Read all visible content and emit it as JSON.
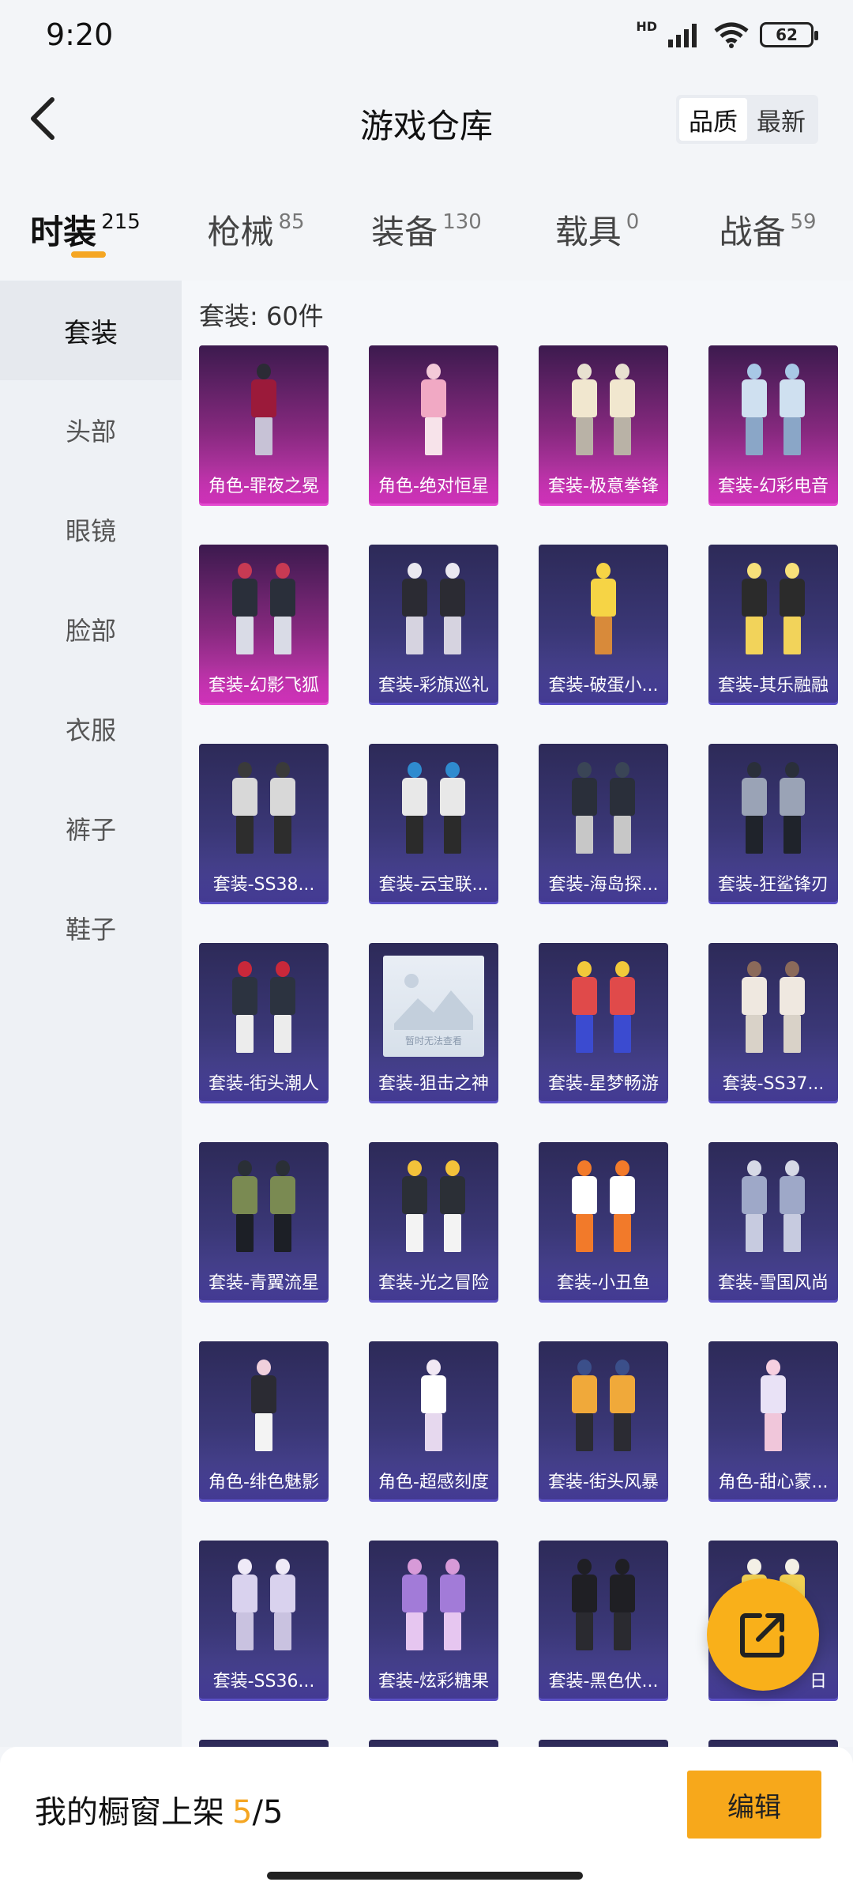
{
  "status": {
    "time": "9:20",
    "battery": "62",
    "network": "HD"
  },
  "header": {
    "title": "游戏仓库",
    "sort_options": [
      "品质",
      "最新"
    ],
    "sort_active": 0
  },
  "categories": [
    {
      "label": "时装",
      "count": "215"
    },
    {
      "label": "枪械",
      "count": "85"
    },
    {
      "label": "装备",
      "count": "130"
    },
    {
      "label": "载具",
      "count": "0"
    },
    {
      "label": "战备",
      "count": "59"
    }
  ],
  "sidebar": {
    "items": [
      "套装",
      "头部",
      "眼镜",
      "脸部",
      "衣服",
      "裤子",
      "鞋子"
    ]
  },
  "section": {
    "title": "套装: 60件"
  },
  "items": [
    {
      "label": "角色-罪夜之冕",
      "theme": "pink"
    },
    {
      "label": "角色-绝对恒星",
      "theme": "pink"
    },
    {
      "label": "套装-极意拳锋",
      "theme": "pink"
    },
    {
      "label": "套装-幻彩电音",
      "theme": "pink"
    },
    {
      "label": "套装-幻影飞狐",
      "theme": "pink"
    },
    {
      "label": "套装-彩旗巡礼",
      "theme": "blue"
    },
    {
      "label": "套装-破蛋小...",
      "theme": "blue"
    },
    {
      "label": "套装-其乐融融",
      "theme": "blue"
    },
    {
      "label": "套装-SS38...",
      "theme": "blue"
    },
    {
      "label": "套装-云宝联...",
      "theme": "blue"
    },
    {
      "label": "套装-海岛探...",
      "theme": "blue"
    },
    {
      "label": "套装-狂鲨锋刃",
      "theme": "blue"
    },
    {
      "label": "套装-街头潮人",
      "theme": "blue"
    },
    {
      "label": "套装-狙击之神",
      "theme": "blue",
      "placeholder": "暂时无法查看"
    },
    {
      "label": "套装-星梦畅游",
      "theme": "blue"
    },
    {
      "label": "套装-SS37...",
      "theme": "blue"
    },
    {
      "label": "套装-青翼流星",
      "theme": "blue"
    },
    {
      "label": "套装-光之冒险",
      "theme": "blue"
    },
    {
      "label": "套装-小丑鱼",
      "theme": "blue"
    },
    {
      "label": "套装-雪国风尚",
      "theme": "blue"
    },
    {
      "label": "角色-绯色魅影",
      "theme": "blue"
    },
    {
      "label": "角色-超感刻度",
      "theme": "blue"
    },
    {
      "label": "套装-街头风暴",
      "theme": "blue"
    },
    {
      "label": "角色-甜心蒙...",
      "theme": "blue"
    },
    {
      "label": "套装-SS36...",
      "theme": "blue"
    },
    {
      "label": "套装-炫彩糖果",
      "theme": "blue"
    },
    {
      "label": "套装-黑色伏...",
      "theme": "blue"
    },
    {
      "label": "日",
      "theme": "blue"
    },
    {
      "label": "",
      "theme": "blue"
    },
    {
      "label": "",
      "theme": "blue"
    },
    {
      "label": "",
      "theme": "blue"
    },
    {
      "label": "",
      "theme": "blue"
    }
  ],
  "shelf": {
    "label": "我的橱窗上架",
    "current": "5",
    "separator": "/",
    "total": "5"
  },
  "edit_button": "编辑",
  "fab": {
    "icon": "share-external-icon"
  },
  "colors": {
    "accent": "#f7a81b",
    "card_pink": "#d33bbb",
    "card_blue": "#4d469c"
  }
}
